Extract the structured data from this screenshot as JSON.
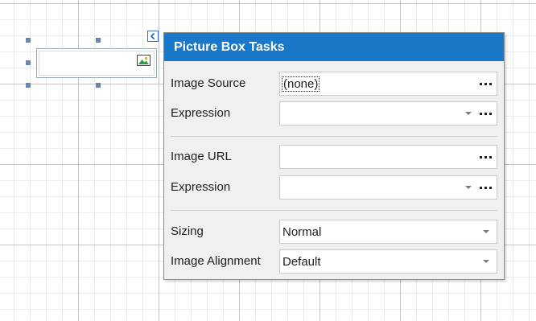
{
  "panel": {
    "title": "Picture Box Tasks",
    "rows": {
      "image_source": {
        "label": "Image Source",
        "value": "(none)"
      },
      "source_expression": {
        "label": "Expression",
        "value": ""
      },
      "image_url": {
        "label": "Image URL",
        "value": ""
      },
      "url_expression": {
        "label": "Expression",
        "value": ""
      },
      "sizing": {
        "label": "Sizing",
        "value": "Normal"
      },
      "image_alignment": {
        "label": "Image Alignment",
        "value": "Default"
      }
    }
  },
  "colors": {
    "header_bg": "#1a78c9",
    "panel_bg": "#f0f0f0",
    "handle": "#6b86a8",
    "smart_tag_border": "#3b6fc5"
  },
  "icons": {
    "picture_box": "image-icon",
    "smart_tag": "chevron-left-icon",
    "ellipsis": "ellipsis-icon",
    "dropdown": "chevron-down-icon"
  }
}
